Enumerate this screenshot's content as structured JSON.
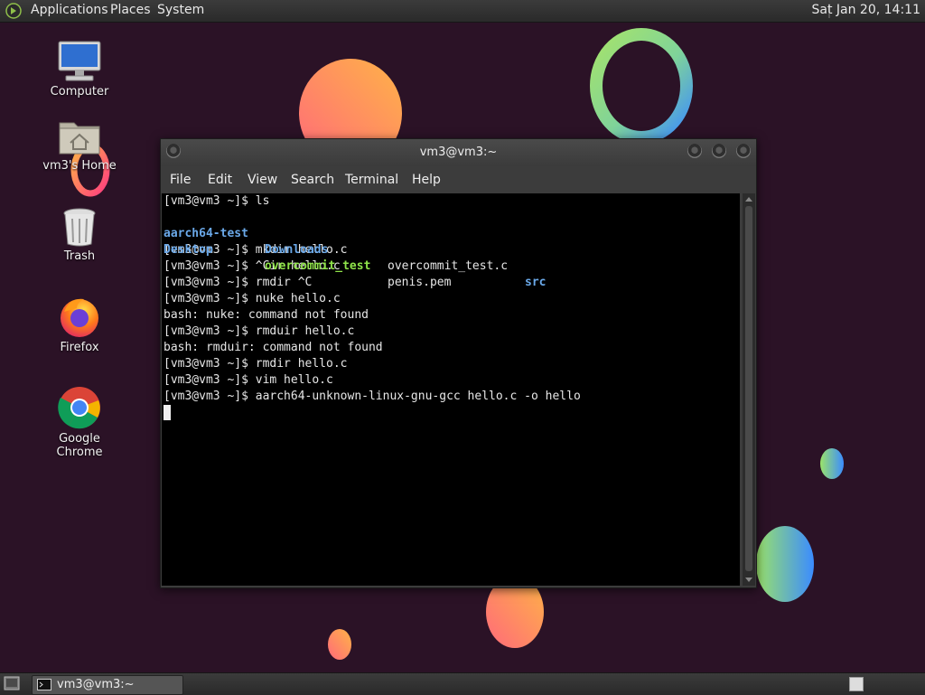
{
  "top_panel": {
    "menus": [
      "Applications",
      "Places",
      "System"
    ],
    "clock": "Sat Jan 20, 14:11"
  },
  "desktop_icons": [
    {
      "label": "Computer",
      "icon": "computer-icon"
    },
    {
      "label": "vm3's Home",
      "icon": "home-folder-icon"
    },
    {
      "label": "Trash",
      "icon": "trash-icon"
    },
    {
      "label": "Firefox",
      "icon": "firefox-icon"
    },
    {
      "label": "Google Chrome",
      "icon": "chrome-icon"
    }
  ],
  "terminal": {
    "title": "vm3@vm3:~",
    "menu": [
      "File",
      "Edit",
      "View",
      "Search",
      "Terminal",
      "Help"
    ],
    "ls_output": {
      "row1": [
        {
          "text": "aarch64-test",
          "kind": "dir"
        },
        {
          "text": "Downloads",
          "kind": "dir"
        },
        {
          "text": "overcommit_test.c",
          "kind": "file"
        },
        {
          "text": "src",
          "kind": "dir"
        }
      ],
      "row2": [
        {
          "text": "Desktop",
          "kind": "dir"
        },
        {
          "text": "overcommit_test",
          "kind": "exe"
        },
        {
          "text": "penis.pem",
          "kind": "file"
        }
      ]
    },
    "lines": [
      "[vm3@vm3 ~]$ ls",
      "[vm3@vm3 ~]$ mkdir hello.c",
      "[vm3@vm3 ~]$ ^Cir hello.c",
      "[vm3@vm3 ~]$ rmdir ^C",
      "[vm3@vm3 ~]$ nuke hello.c",
      "bash: nuke: command not found",
      "[vm3@vm3 ~]$ rmduir hello.c",
      "bash: rmduir: command not found",
      "[vm3@vm3 ~]$ rmdir hello.c",
      "[vm3@vm3 ~]$ vim hello.c",
      "[vm3@vm3 ~]$ aarch64-unknown-linux-gnu-gcc hello.c -o hello"
    ],
    "colors": {
      "dir": "#6aa8e8",
      "exe": "#8fe34a",
      "text": "#e6e6e6"
    }
  },
  "taskbar": {
    "task_label": "vm3@vm3:~"
  }
}
